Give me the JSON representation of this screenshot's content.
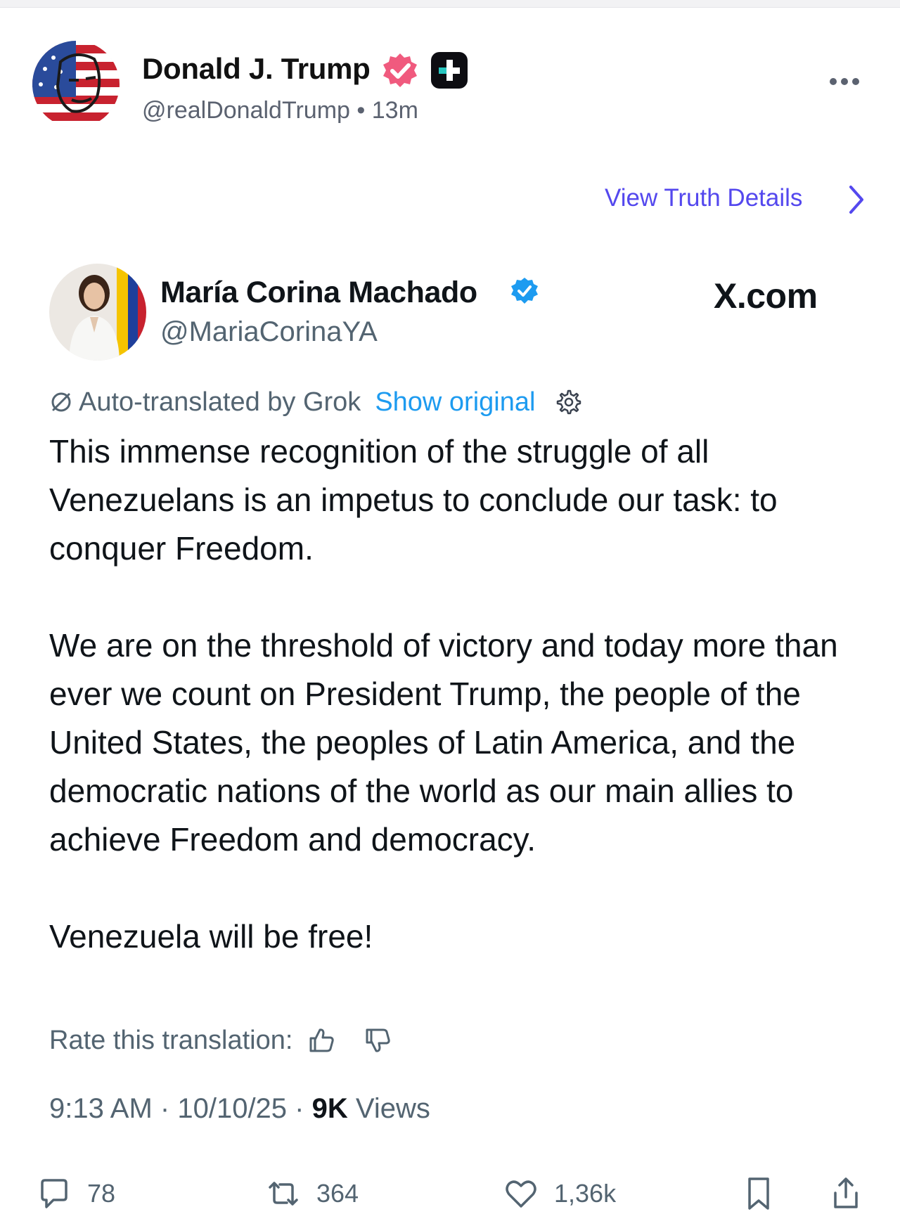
{
  "truth_post": {
    "author_name": "Donald J. Trump",
    "handle": "@realDonaldTrump",
    "separator": "•",
    "time_ago": "13m",
    "view_details_label": "View Truth Details",
    "icons": {
      "verified": "verified-badge-icon",
      "plus": "plus-badge-icon",
      "more": "more-icon",
      "chevron": "chevron-right-icon"
    },
    "colors": {
      "verified_badge": "#f05a7e",
      "link": "#5448ee"
    }
  },
  "embedded_post": {
    "author_name": "María Corina Machado",
    "handle": "@MariaCorinaYA",
    "brand": "X.com",
    "translation_note": "Auto-translated by Grok",
    "show_original_label": "Show original",
    "paragraphs": [
      "This immense recognition of the struggle of all Venezuelans is an impetus to conclude our task: to conquer Freedom.",
      "We are on the threshold of victory and today more than ever we count on President Trump, the people of the United States, the peoples of Latin America, and the democratic nations of the world as our main allies to achieve Freedom and democracy.",
      "Venezuela will be free!"
    ],
    "rate_label": "Rate this translation:",
    "time": "9:13 AM",
    "date": "10/10/25",
    "meta_sep": "·",
    "views_count": "9K",
    "views_label": "Views",
    "colors": {
      "verified_badge": "#1d9bf0",
      "link": "#1d9bf0",
      "muted": "#536471"
    }
  },
  "actions": {
    "reply_count": "78",
    "repost_count": "364",
    "like_count": "1,36k"
  }
}
